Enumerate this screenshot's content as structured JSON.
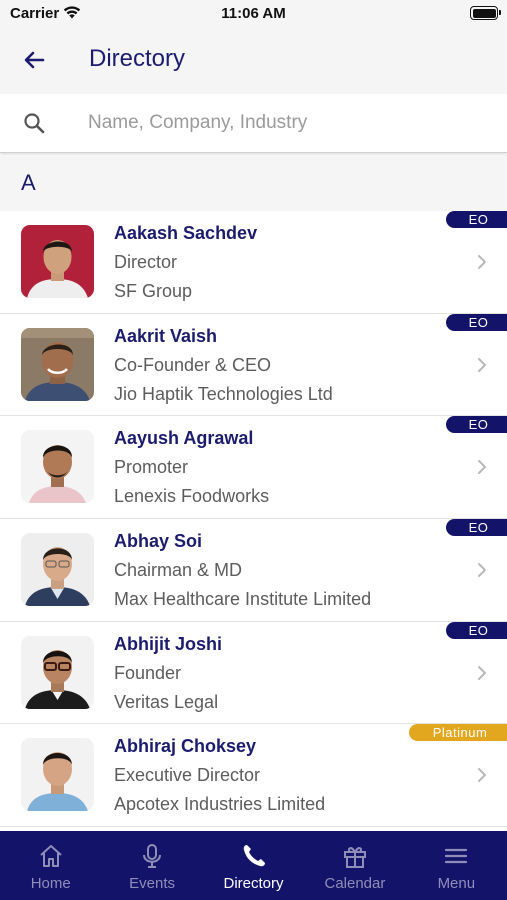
{
  "status_bar": {
    "carrier": "Carrier",
    "time": "11:06 AM"
  },
  "header": {
    "title": "Directory"
  },
  "search": {
    "placeholder": "Name, Company, Industry"
  },
  "section": {
    "letter": "A"
  },
  "people": [
    {
      "name": "Aakash Sachdev",
      "title": "Director",
      "company": "SF Group",
      "badge": "EO",
      "avatar_bg": "#b1213a"
    },
    {
      "name": "Aakrit Vaish",
      "title": "Co-Founder & CEO",
      "company": "Jio Haptik Technologies Ltd",
      "badge": "EO",
      "avatar_bg": "#7a6a5a"
    },
    {
      "name": "Aayush Agrawal",
      "title": "Promoter",
      "company": "Lenexis Foodworks",
      "badge": "EO",
      "avatar_bg": "#f4f4f4"
    },
    {
      "name": "Abhay Soi",
      "title": "Chairman & MD",
      "company": "Max Healthcare Institute Limited",
      "badge": "EO",
      "avatar_bg": "#eeeeee"
    },
    {
      "name": "Abhijit Joshi",
      "title": "Founder",
      "company": "Veritas Legal",
      "badge": "EO",
      "avatar_bg": "#f2f2f2"
    },
    {
      "name": "Abhiraj Choksey",
      "title": "Executive Director",
      "company": "Apcotex Industries Limited",
      "badge": "Platinum",
      "avatar_bg": "#f2f2f2"
    }
  ],
  "tabs": [
    {
      "label": "Home",
      "icon": "home-icon",
      "active": false
    },
    {
      "label": "Events",
      "icon": "microphone-icon",
      "active": false
    },
    {
      "label": "Directory",
      "icon": "phone-icon",
      "active": true
    },
    {
      "label": "Calendar",
      "icon": "gift-icon",
      "active": false
    },
    {
      "label": "Menu",
      "icon": "menu-icon",
      "active": false
    }
  ],
  "colors": {
    "brand": "#14136a",
    "platinum": "#e2a71f",
    "inactive_tab": "#8e8eb8"
  }
}
